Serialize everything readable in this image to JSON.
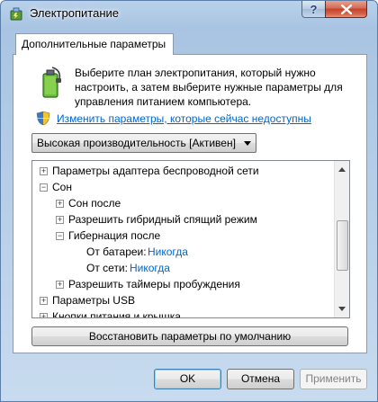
{
  "window": {
    "title": "Электропитание",
    "help_label": "?",
    "close_label": "x"
  },
  "tab": {
    "label": "Дополнительные параметры"
  },
  "intro": {
    "text": "Выберите план электропитания, который нужно настроить, а затем выберите нужные параметры для управления питанием компьютера."
  },
  "change_link": "Изменить параметры, которые сейчас недоступны",
  "plan_select": {
    "value": "Высокая производительность [Активен]"
  },
  "tree": {
    "rows": [
      {
        "label": "Параметры адаптера беспроводной сети",
        "expander": "+"
      },
      {
        "label": "Сон",
        "expander": "−"
      },
      {
        "label": "Сон после",
        "expander": "+"
      },
      {
        "label": "Разрешить гибридный спящий режим",
        "expander": "+"
      },
      {
        "label": "Гибернация после",
        "expander": "−"
      },
      {
        "label": "От батареи:",
        "value": "Никогда"
      },
      {
        "label": "От сети:",
        "value": "Никогда"
      },
      {
        "label": "Разрешить таймеры пробуждения",
        "expander": "+"
      },
      {
        "label": "Параметры USB",
        "expander": "+"
      },
      {
        "label": "Кнопки питания и крышка",
        "expander": "+"
      }
    ]
  },
  "restore_button": "Восстановить параметры по умолчанию",
  "buttons": {
    "ok": "OK",
    "cancel": "Отмена",
    "apply": "Применить"
  },
  "colors": {
    "link": "#0066cc",
    "frame": "#b9d1ea",
    "close": "#c2442a"
  }
}
